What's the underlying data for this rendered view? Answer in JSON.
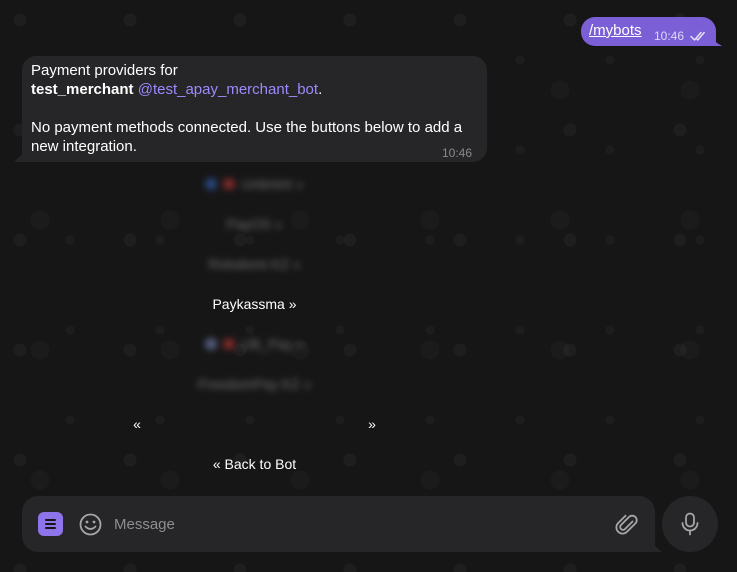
{
  "outgoing_message": {
    "text": "/mybots",
    "time": "10:46",
    "status_icon": "double-check-icon"
  },
  "incoming_message": {
    "line1": "Payment providers for",
    "merchant_name": "test_merchant",
    "bot_username": "@test_apay_merchant_bot",
    "trailing_dot": ".",
    "line3": "No payment methods connected. Use the buttons below to add a",
    "line4": "new integration.",
    "time": "10:46"
  },
  "keyboard": {
    "row1_label": "Unlimint »",
    "row2_label": "PayOS »",
    "row3_label": "Rolodomi KZ »",
    "row4_label": "Paykassma »",
    "row5_label": "UB_Pay »",
    "row6_label": "FreedomPay KZ »",
    "prev_label": "«",
    "next_label": "»",
    "back_label": "« Back to Bot"
  },
  "composer": {
    "placeholder": "Message",
    "menu_icon": "bot-menu-icon",
    "emoji_icon": "emoji-icon",
    "attach_icon": "paperclip-icon",
    "mic_icon": "microphone-icon"
  },
  "colors": {
    "accent": "#7b5fd6",
    "menu_button": "#8e74ea",
    "mention": "#9c8aff",
    "bubble": "#262628",
    "background": "#161616"
  }
}
